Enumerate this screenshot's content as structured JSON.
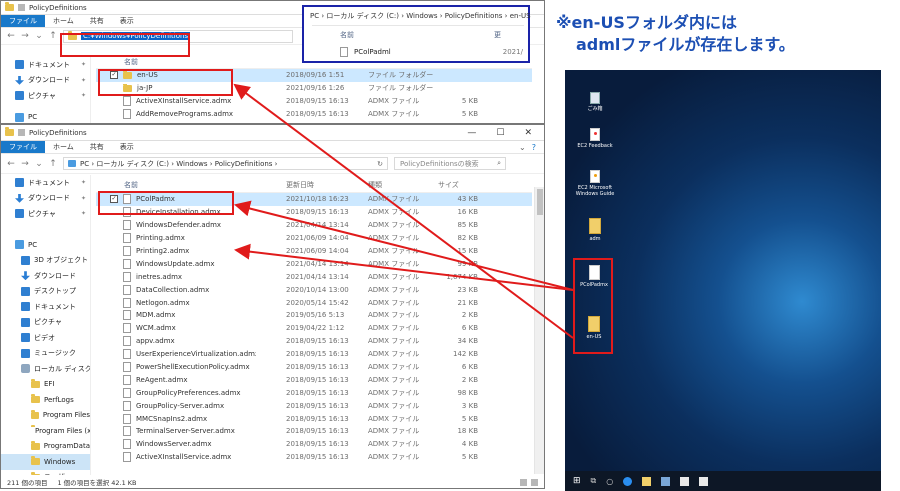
{
  "note": {
    "line1": "※en-USフォルダ内には",
    "line2": "admlファイルが存在します。"
  },
  "win_top": {
    "title": "PolicyDefinitions",
    "tabs": [
      "ファイル",
      "ホーム",
      "共有",
      "表示"
    ],
    "address": "C:¥Windows¥PolicyDefinitions",
    "nav_items": [
      {
        "label": "ドキュメント",
        "icon": "documents-icon"
      },
      {
        "label": "ダウンロード",
        "icon": "downloads-icon"
      },
      {
        "label": "ピクチャ",
        "icon": "pictures-icon"
      },
      {
        "label": "PC",
        "icon": "pc-icon"
      }
    ],
    "header": {
      "name": "名前"
    },
    "rows": [
      {
        "name": "en-US",
        "date": "2018/09/16 1:51",
        "type": "ファイル フォルダー",
        "size": "",
        "kind": "folder",
        "selected": true
      },
      {
        "name": "ja-JP",
        "date": "2021/09/16 1:26",
        "type": "ファイル フォルダー",
        "size": "",
        "kind": "folder"
      },
      {
        "name": "ActiveXInstallService.admx",
        "date": "2018/09/15 16:13",
        "type": "ADMX ファイル",
        "size": "5 KB",
        "kind": "file"
      },
      {
        "name": "AddRemovePrograms.admx",
        "date": "2018/09/15 16:13",
        "type": "ADMX ファイル",
        "size": "5 KB",
        "kind": "file"
      }
    ]
  },
  "popup": {
    "breadcrumb": "PC › ローカル ディスク (C:) › Windows › PolicyDefinitions › en-US",
    "header_name": "名前",
    "header_date": "更",
    "file": "PColPadml",
    "file_date": "2021/"
  },
  "win_bottom": {
    "title": "PolicyDefinitions",
    "tabs": [
      "ファイル",
      "ホーム",
      "共有",
      "表示"
    ],
    "breadcrumb": "PC › ローカル ディスク (C:) › Windows › PolicyDefinitions ›",
    "search_placeholder": "PolicyDefinitionsの検索",
    "header": {
      "name": "名前",
      "date": "更新日時",
      "type": "種類",
      "size": "サイズ"
    },
    "nav_items": [
      {
        "label": "ドキュメント",
        "icon": "documents-icon",
        "pin": true
      },
      {
        "label": "ダウンロード",
        "icon": "downloads-icon",
        "pin": true
      },
      {
        "label": "ピクチャ",
        "icon": "pictures-icon",
        "pin": true
      },
      {
        "label": "",
        "icon": "spacer"
      },
      {
        "label": "PC",
        "icon": "pc-icon"
      },
      {
        "label": "3D オブジェクト",
        "icon": "objects-3d-icon"
      },
      {
        "label": "ダウンロード",
        "icon": "downloads-icon"
      },
      {
        "label": "デスクトップ",
        "icon": "desktop-icon"
      },
      {
        "label": "ドキュメント",
        "icon": "documents-icon"
      },
      {
        "label": "ピクチャ",
        "icon": "pictures-icon"
      },
      {
        "label": "ビデオ",
        "icon": "videos-icon"
      },
      {
        "label": "ミュージック",
        "icon": "music-icon"
      },
      {
        "label": "ローカル ディスク (C",
        "icon": "drive-icon"
      },
      {
        "label": "EFI",
        "icon": "folder-icon"
      },
      {
        "label": "PerfLogs",
        "icon": "folder-icon"
      },
      {
        "label": "Program Files",
        "icon": "folder-icon"
      },
      {
        "label": "Program Files (x",
        "icon": "folder-icon"
      },
      {
        "label": "ProgramData",
        "icon": "folder-icon"
      },
      {
        "label": "Windows",
        "icon": "folder-icon",
        "selected": true
      },
      {
        "label": "ユーザー",
        "icon": "folder-icon"
      }
    ],
    "rows": [
      {
        "name": "PColPadmx",
        "date": "2021/10/18 16:23",
        "type": "ADMX ファイル",
        "size": "43 KB",
        "selected": true
      },
      {
        "name": "DeviceInstallation.admx",
        "date": "2018/09/15 16:13",
        "type": "ADMX ファイル",
        "size": "16 KB"
      },
      {
        "name": "WindowsDefender.admx",
        "date": "2021/04/14 13:14",
        "type": "ADMX ファイル",
        "size": "85 KB"
      },
      {
        "name": "Printing.admx",
        "date": "2021/06/09 14:04",
        "type": "ADMX ファイル",
        "size": "82 KB"
      },
      {
        "name": "Printing2.admx",
        "date": "2021/06/09 14:04",
        "type": "ADMX ファイル",
        "size": "15 KB"
      },
      {
        "name": "WindowsUpdate.admx",
        "date": "2021/04/14 13:14",
        "type": "ADMX ファイル",
        "size": "99 KB"
      },
      {
        "name": "inetres.admx",
        "date": "2021/04/14 13:14",
        "type": "ADMX ファイル",
        "size": "1,674 KB"
      },
      {
        "name": "DataCollection.admx",
        "date": "2020/10/14 13:00",
        "type": "ADMX ファイル",
        "size": "23 KB"
      },
      {
        "name": "Netlogon.admx",
        "date": "2020/05/14 15:42",
        "type": "ADMX ファイル",
        "size": "21 KB"
      },
      {
        "name": "MDM.admx",
        "date": "2019/05/16 5:13",
        "type": "ADMX ファイル",
        "size": "2 KB"
      },
      {
        "name": "WCM.admx",
        "date": "2019/04/22 1:12",
        "type": "ADMX ファイル",
        "size": "6 KB"
      },
      {
        "name": "appv.admx",
        "date": "2018/09/15 16:13",
        "type": "ADMX ファイル",
        "size": "34 KB"
      },
      {
        "name": "UserExperienceVirtualization.admx",
        "date": "2018/09/15 16:13",
        "type": "ADMX ファイル",
        "size": "142 KB"
      },
      {
        "name": "PowerShellExecutionPolicy.admx",
        "date": "2018/09/15 16:13",
        "type": "ADMX ファイル",
        "size": "6 KB"
      },
      {
        "name": "ReAgent.admx",
        "date": "2018/09/15 16:13",
        "type": "ADMX ファイル",
        "size": "2 KB"
      },
      {
        "name": "GroupPolicyPreferences.admx",
        "date": "2018/09/15 16:13",
        "type": "ADMX ファイル",
        "size": "98 KB"
      },
      {
        "name": "GroupPolicy-Server.admx",
        "date": "2018/09/15 16:13",
        "type": "ADMX ファイル",
        "size": "3 KB"
      },
      {
        "name": "MMCSnapIns2.admx",
        "date": "2018/09/15 16:13",
        "type": "ADMX ファイル",
        "size": "5 KB"
      },
      {
        "name": "TerminalServer-Server.admx",
        "date": "2018/09/15 16:13",
        "type": "ADMX ファイル",
        "size": "18 KB"
      },
      {
        "name": "WindowsServer.admx",
        "date": "2018/09/15 16:13",
        "type": "ADMX ファイル",
        "size": "4 KB"
      },
      {
        "name": "ActiveXInstallService.admx",
        "date": "2018/09/15 16:13",
        "type": "ADMX ファイル",
        "size": "5 KB"
      }
    ],
    "status": {
      "count": "211 個の項目",
      "selected": "1 個の項目を選択  42.1 KB"
    }
  },
  "desktop": {
    "icons": [
      {
        "label": "ごみ箱",
        "icon": "recycle-bin-icon"
      },
      {
        "label": "EC2 Feedback",
        "icon": "ec2-feedback-icon"
      },
      {
        "label": "EC2 Microsoft Windows Guide",
        "icon": "ec2-guide-icon"
      },
      {
        "label": "adm",
        "icon": "folder-icon"
      },
      {
        "label": "PColPadmx",
        "icon": "file-icon"
      },
      {
        "label": "en-US",
        "icon": "folder-icon"
      }
    ]
  },
  "colors": {
    "accent": "#1979ca",
    "annotation_red": "#e01b1b",
    "annotation_blue": "#1a23a8",
    "note_text": "#1c4fb3"
  }
}
